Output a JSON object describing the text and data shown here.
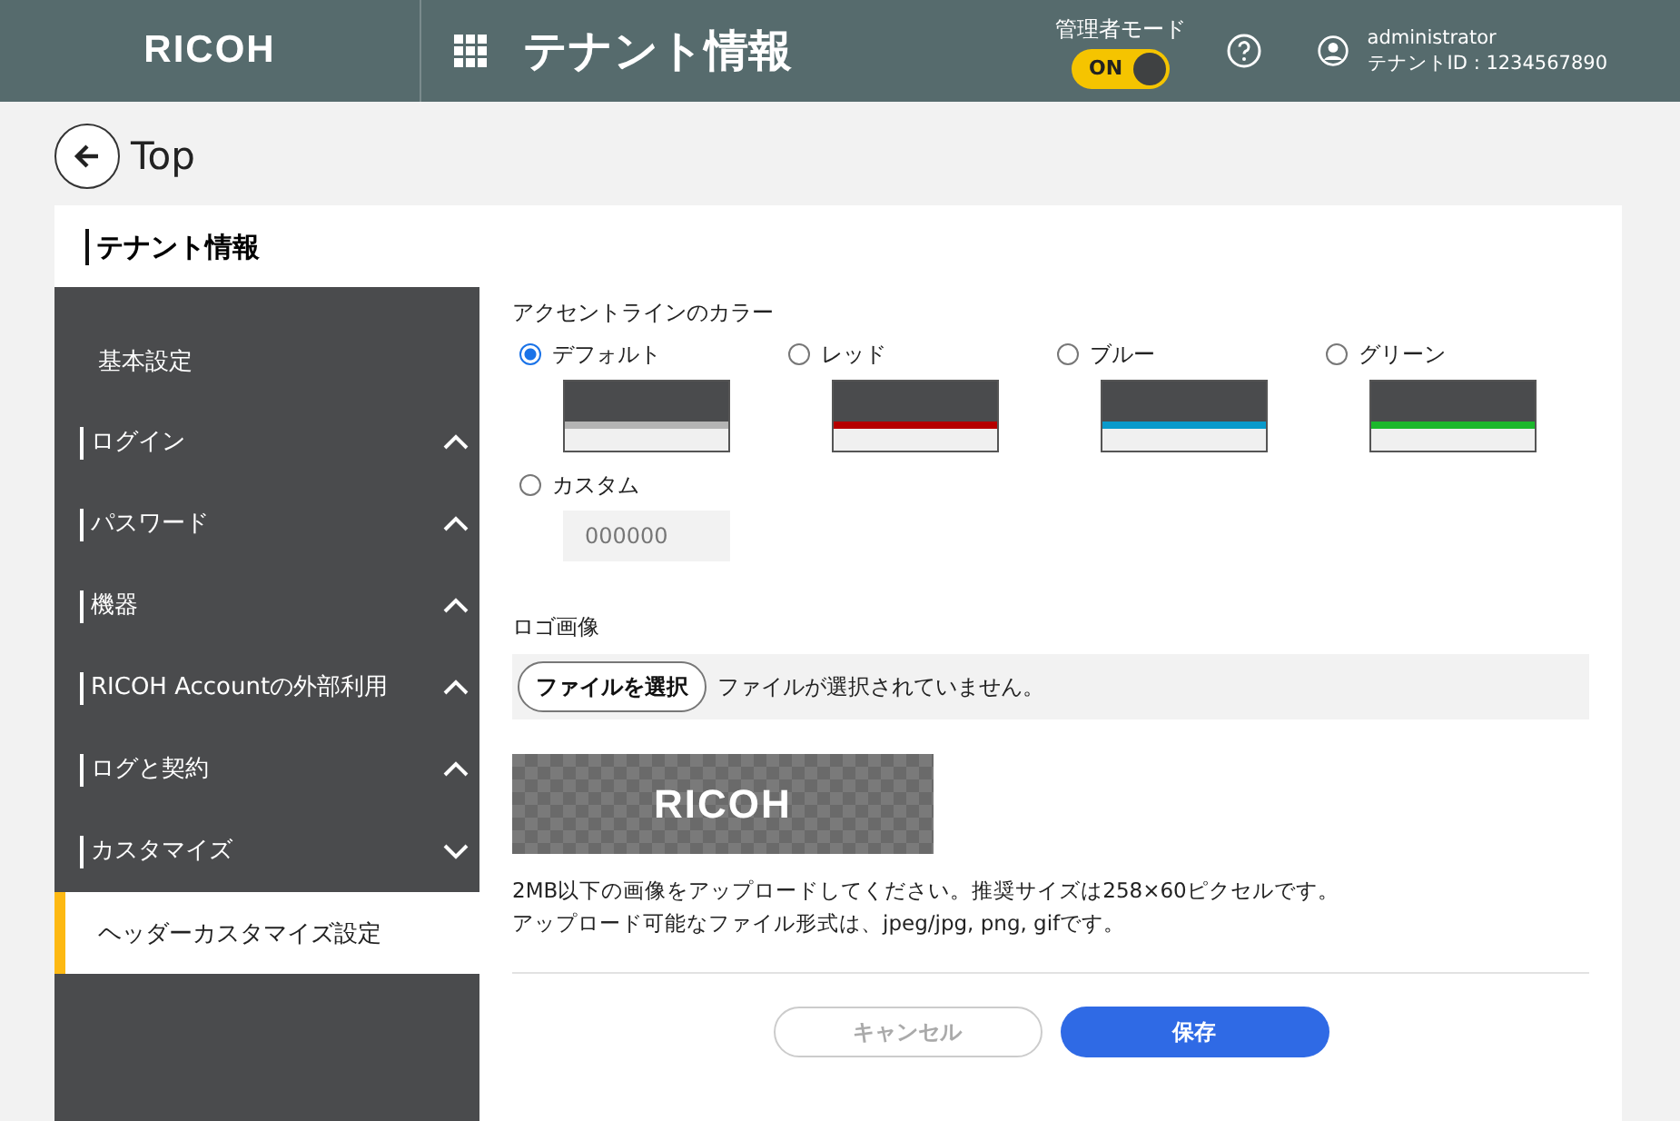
{
  "header": {
    "logo": "RICOH",
    "title": "テナント情報",
    "admin_mode": {
      "label": "管理者モード",
      "toggle_text": "ON",
      "on": true
    },
    "user": {
      "name": "administrator",
      "tenant": "テナントID : 1234567890"
    }
  },
  "back": {
    "label": "Top"
  },
  "card_title": "テナント情報",
  "sidebar": {
    "items": [
      {
        "label": "基本設定",
        "kind": "link",
        "selected": false
      },
      {
        "label": "ログイン",
        "kind": "section",
        "expanded": false
      },
      {
        "label": "パスワード",
        "kind": "section",
        "expanded": false
      },
      {
        "label": "機器",
        "kind": "section",
        "expanded": false
      },
      {
        "label": "RICOH Accountの外部利用",
        "kind": "section",
        "expanded": false
      },
      {
        "label": "ログと契約",
        "kind": "section",
        "expanded": false
      },
      {
        "label": "カスタマイズ",
        "kind": "section",
        "expanded": true,
        "children": [
          {
            "label": "ヘッダーカスタマイズ設定",
            "selected": true
          }
        ]
      }
    ]
  },
  "accent": {
    "label": "アクセントラインのカラー",
    "options": [
      {
        "label": "デフォルト",
        "color": "#b4b4b4",
        "selected": true
      },
      {
        "label": "レッド",
        "color": "#b50000",
        "selected": false
      },
      {
        "label": "ブルー",
        "color": "#0a9acb",
        "selected": false
      },
      {
        "label": "グリーン",
        "color": "#1cb82c",
        "selected": false
      }
    ],
    "custom": {
      "label": "カスタム",
      "selected": false,
      "value": "000000",
      "disabled": true
    }
  },
  "logo": {
    "label": "ロゴ画像",
    "file_button": "ファイルを選択",
    "file_status": "ファイルが選択されていません。",
    "preview_text": "RICOH",
    "notes": [
      "2MB以下の画像をアップロードしてください。推奨サイズは258×60ピクセルです。",
      "アップロード可能なファイル形式は、jpeg/jpg, png, gifです。"
    ]
  },
  "buttons": [
    {
      "label": "キャンセル",
      "kind": "secondary",
      "disabled": true
    },
    {
      "label": "保存",
      "kind": "primary",
      "disabled": false
    }
  ]
}
